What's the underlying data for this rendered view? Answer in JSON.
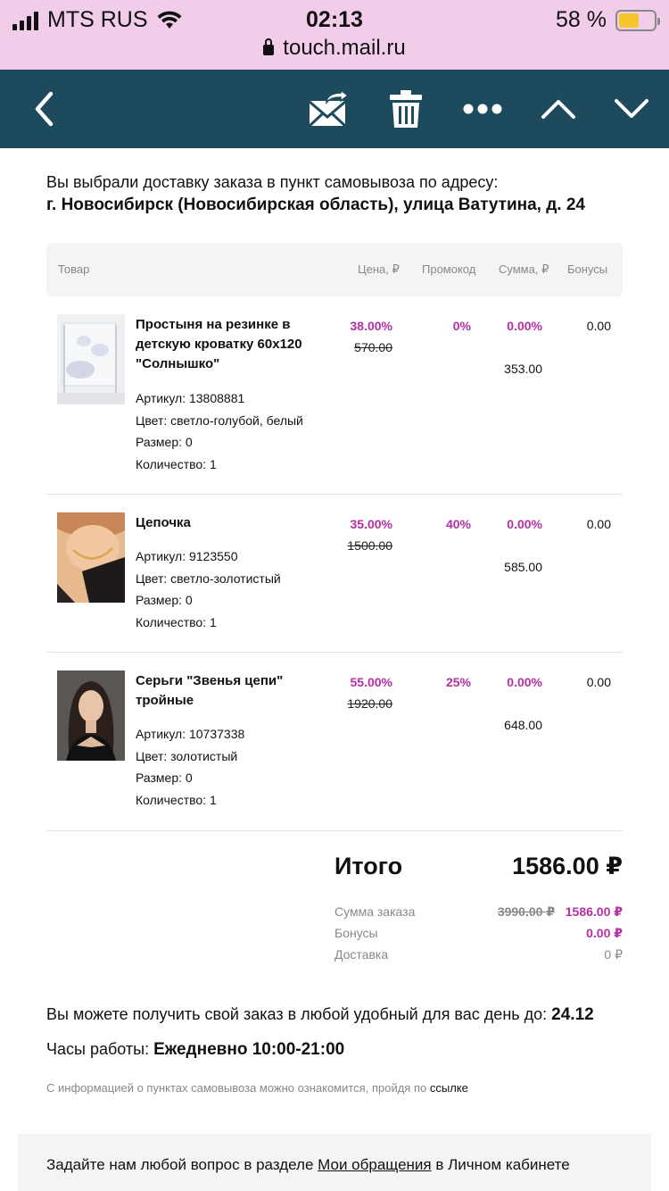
{
  "status_bar": {
    "carrier": "MTS RUS",
    "time": "02:13",
    "battery_percent": "58 %",
    "battery_level": 0.58,
    "url": "touch.mail.ru"
  },
  "toolbar": {
    "icons": [
      "back-chevron-icon",
      "reply-envelope-icon",
      "trash-icon",
      "more-dots-icon",
      "chevron-up-icon",
      "chevron-down-icon"
    ]
  },
  "delivery": {
    "intro": "Вы выбрали доставку заказа в пункт самовывоза по адресу:",
    "address": "г. Новосибирск (Новосибирская область), улица Ватутина, д. 24"
  },
  "table": {
    "headers": {
      "product": "Товар",
      "price": "Цена, ₽",
      "promo": "Промокод",
      "sum": "Сумма, ₽",
      "bonus": "Бонусы"
    },
    "items": [
      {
        "name": "Простыня на резинке в детскую кроватку 60х120 \"Солнышко\"",
        "article": "Артикул: 13808881",
        "color": "Цвет: светло-голубой, белый",
        "size": "Размер: 0",
        "qty": "Количество: 1",
        "discount": "38.00%",
        "old_price": "570.00",
        "promo": "0%",
        "sum_pct": "0.00%",
        "sum": "353.00",
        "bonus": "0.00"
      },
      {
        "name": "Цепочка",
        "article": "Артикул: 9123550",
        "color": "Цвет: светло-золотистый",
        "size": "Размер: 0",
        "qty": "Количество: 1",
        "discount": "35.00%",
        "old_price": "1500.00",
        "promo": "40%",
        "sum_pct": "0.00%",
        "sum": "585.00",
        "bonus": "0.00"
      },
      {
        "name": "Серьги \"Звенья цепи\" тройные",
        "article": "Артикул: 10737338",
        "color": "Цвет: золотистый",
        "size": "Размер: 0",
        "qty": "Количество: 1",
        "discount": "55.00%",
        "old_price": "1920.00",
        "promo": "25%",
        "sum_pct": "0.00%",
        "sum": "648.00",
        "bonus": "0.00"
      }
    ]
  },
  "totals": {
    "label": "Итого",
    "value": "1586.00 ₽",
    "order_sum_label": "Сумма заказа",
    "order_sum_old": "3990.00 ₽",
    "order_sum_new": "1586.00 ₽",
    "bonus_label": "Бонусы",
    "bonus_value": "0.00 ₽",
    "delivery_label": "Доставка",
    "delivery_value": "0 ₽"
  },
  "pickup": {
    "until_text": "Вы можете получить свой заказ в любой удобный для вас день до:",
    "until_date": "24.12",
    "hours_label": "Часы работы:",
    "hours_value": "Ежедневно 10:00-21:00",
    "info_text": "С информацией о пунктах самовывоза можно ознакомится, пройдя по",
    "info_link": "ссылке"
  },
  "footer": {
    "text_before": "Задайте нам любой вопрос в разделе",
    "link": "Мои обращения",
    "text_after": "в Личном кабинете"
  },
  "colors": {
    "status_bg": "#f2cdea",
    "toolbar_bg": "#1d4a5c",
    "accent_pink": "#b52fa4",
    "header_bg": "#f4f4f4"
  }
}
